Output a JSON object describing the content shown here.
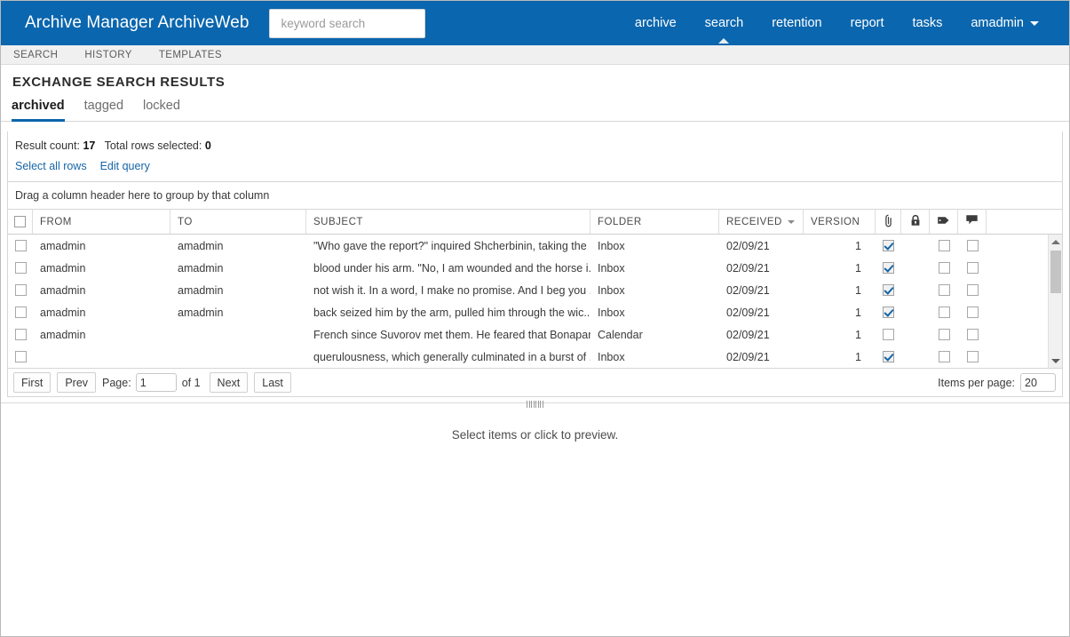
{
  "header": {
    "brand": "Archive Manager ArchiveWeb",
    "search": {
      "value": "",
      "placeholder": "keyword search"
    },
    "nav": [
      {
        "label": "archive",
        "active": false
      },
      {
        "label": "search",
        "active": true
      },
      {
        "label": "retention",
        "active": false
      },
      {
        "label": "report",
        "active": false
      },
      {
        "label": "tasks",
        "active": false
      }
    ],
    "user": "amadmin"
  },
  "subbar": {
    "items": [
      "SEARCH",
      "HISTORY",
      "TEMPLATES"
    ]
  },
  "page": {
    "title": "EXCHANGE SEARCH RESULTS"
  },
  "state_tabs": [
    {
      "label": "archived",
      "active": true
    },
    {
      "label": "tagged",
      "active": false
    },
    {
      "label": "locked",
      "active": false
    }
  ],
  "result": {
    "count_label": "Result count:",
    "count_value": "17",
    "selected_label": "Total rows selected:",
    "selected_value": "0",
    "select_all_link": "Select all rows",
    "edit_query_link": "Edit query"
  },
  "group_bar": {
    "hint": "Drag a column header here to group by that column"
  },
  "grid": {
    "columns": [
      {
        "key": "check",
        "label": "",
        "icon": "checkbox-icon"
      },
      {
        "key": "from",
        "label": "FROM"
      },
      {
        "key": "to",
        "label": "TO"
      },
      {
        "key": "subject",
        "label": "SUBJECT"
      },
      {
        "key": "folder",
        "label": "FOLDER"
      },
      {
        "key": "received",
        "label": "RECEIVED",
        "sorted": true
      },
      {
        "key": "version",
        "label": "VERSION"
      },
      {
        "key": "attachment",
        "label": "",
        "icon": "paperclip-icon"
      },
      {
        "key": "locked",
        "label": "",
        "icon": "lock-icon"
      },
      {
        "key": "tag",
        "label": "",
        "icon": "tag-icon"
      },
      {
        "key": "comment",
        "label": "",
        "icon": "speech-bubble-icon"
      },
      {
        "key": "spacer",
        "label": ""
      }
    ],
    "rows": [
      {
        "selected": false,
        "from": "amadmin",
        "to": "amadmin",
        "subject": "\"Who gave the report?\" inquired Shcherbinin, taking the ...",
        "folder": "Inbox",
        "received": "02/09/21",
        "version": "1",
        "attachment": true,
        "tag": false,
        "comment": false
      },
      {
        "selected": false,
        "from": "amadmin",
        "to": "amadmin",
        "subject": "blood under his arm. \"No, I am wounded and the horse i...",
        "folder": "Inbox",
        "received": "02/09/21",
        "version": "1",
        "attachment": true,
        "tag": false,
        "comment": false
      },
      {
        "selected": false,
        "from": "amadmin",
        "to": "amadmin",
        "subject": "not wish it. In a word, I make no promise. And I beg you ...",
        "folder": "Inbox",
        "received": "02/09/21",
        "version": "1",
        "attachment": true,
        "tag": false,
        "comment": false
      },
      {
        "selected": false,
        "from": "amadmin",
        "to": "amadmin",
        "subject": "back seized him by the arm, pulled him through the wic...",
        "folder": "Inbox",
        "received": "02/09/21",
        "version": "1",
        "attachment": true,
        "tag": false,
        "comment": false
      },
      {
        "selected": false,
        "from": "amadmin",
        "to": "",
        "subject": "French since Suvorov met them. He feared that Bonapart...",
        "folder": "Calendar",
        "received": "02/09/21",
        "version": "1",
        "attachment": false,
        "tag": false,
        "comment": false
      },
      {
        "selected": false,
        "from": "",
        "to": "",
        "subject": "querulousness, which generally culminated in a burst of ...",
        "folder": "Inbox",
        "received": "02/09/21",
        "version": "1",
        "attachment": true,
        "tag": false,
        "comment": false
      }
    ]
  },
  "pager": {
    "first": "First",
    "prev": "Prev",
    "page_label": "Page:",
    "page_value": "1",
    "of_text": "of 1",
    "next": "Next",
    "last": "Last",
    "items_per_page_label": "Items per page:",
    "items_per_page_value": "20"
  },
  "preview": {
    "message": "Select items or click to preview."
  },
  "colors": {
    "brand_blue": "#0a66ae",
    "link_blue": "#1665a8",
    "accent_underline": "#0a66ae",
    "check_blue": "#1565a8"
  }
}
